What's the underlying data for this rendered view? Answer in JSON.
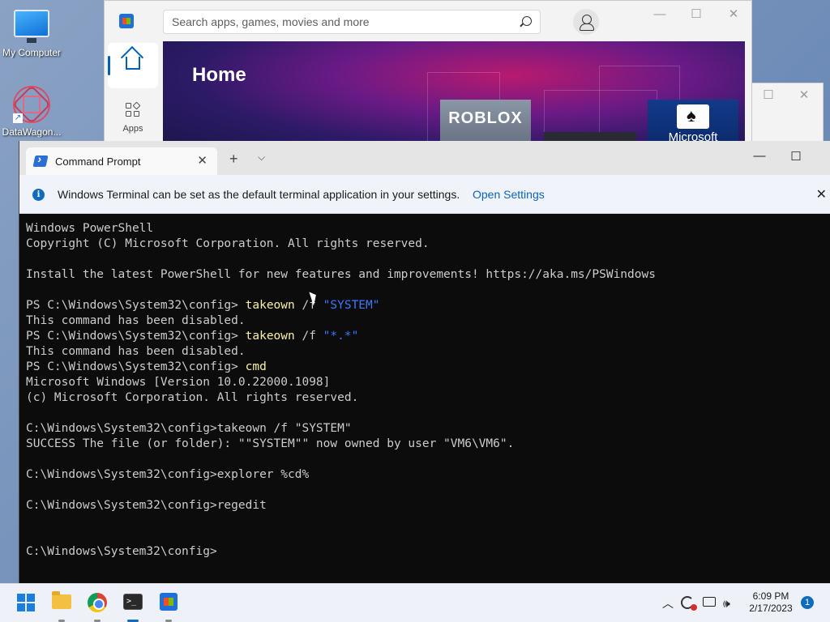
{
  "desktop": {
    "icons": [
      {
        "label": "My Computer"
      },
      {
        "label": "DataWagon..."
      }
    ]
  },
  "store": {
    "search_placeholder": "Search apps, games, movies and more",
    "nav": {
      "apps_label": "Apps"
    },
    "hero_title": "Home",
    "tiles": [
      {
        "label": "ROBLOX"
      },
      {
        "label": "Microsoft"
      }
    ]
  },
  "terminal": {
    "tab_title": "Command Prompt",
    "info_bar": {
      "text": "Windows Terminal can be set as the default terminal application in your settings.",
      "link": "Open Settings"
    },
    "lines": [
      [
        {
          "t": "Windows PowerShell"
        }
      ],
      [
        {
          "t": "Copyright (C) Microsoft Corporation. All rights reserved."
        }
      ],
      [
        {
          "t": ""
        }
      ],
      [
        {
          "t": "Install the latest PowerShell for new features and improvements! https://aka.ms/PSWindows"
        }
      ],
      [
        {
          "t": ""
        }
      ],
      [
        {
          "t": "PS C:\\Windows\\System32\\config> "
        },
        {
          "t": "takeown",
          "c": "cmd"
        },
        {
          "t": " /f "
        },
        {
          "t": "\"SYSTEM\"",
          "c": "str"
        }
      ],
      [
        {
          "t": "This command has been disabled."
        }
      ],
      [
        {
          "t": "PS C:\\Windows\\System32\\config> "
        },
        {
          "t": "takeown",
          "c": "cmd"
        },
        {
          "t": " /f "
        },
        {
          "t": "\"*.*\"",
          "c": "str"
        }
      ],
      [
        {
          "t": "This command has been disabled."
        }
      ],
      [
        {
          "t": "PS C:\\Windows\\System32\\config> "
        },
        {
          "t": "cmd",
          "c": "cmd"
        }
      ],
      [
        {
          "t": "Microsoft Windows [Version 10.0.22000.1098]"
        }
      ],
      [
        {
          "t": "(c) Microsoft Corporation. All rights reserved."
        }
      ],
      [
        {
          "t": ""
        }
      ],
      [
        {
          "t": "C:\\Windows\\System32\\config>takeown /f \"SYSTEM\""
        }
      ],
      [
        {
          "t": "SUCCESS The file (or folder): \"\"SYSTEM\"\" now owned by user \"VM6\\VM6\"."
        }
      ],
      [
        {
          "t": ""
        }
      ],
      [
        {
          "t": "C:\\Windows\\System32\\config>explorer %cd%"
        }
      ],
      [
        {
          "t": ""
        }
      ],
      [
        {
          "t": "C:\\Windows\\System32\\config>regedit"
        }
      ],
      [
        {
          "t": ""
        }
      ],
      [
        {
          "t": ""
        }
      ],
      [
        {
          "t": "C:\\Windows\\System32\\config>"
        }
      ]
    ]
  },
  "taskbar": {
    "time": "6:09 PM",
    "date": "2/17/2023",
    "notification_count": "1",
    "apps": [
      "start-button",
      "file-explorer",
      "chrome",
      "terminal",
      "microsoft-store"
    ]
  },
  "colors": {
    "terminal_bg": "#0c0c0c",
    "terminal_text": "#cccccc",
    "ps_command": "#f9f1a5",
    "ps_string": "#3b78ff",
    "accent": "#0f6cbd"
  }
}
